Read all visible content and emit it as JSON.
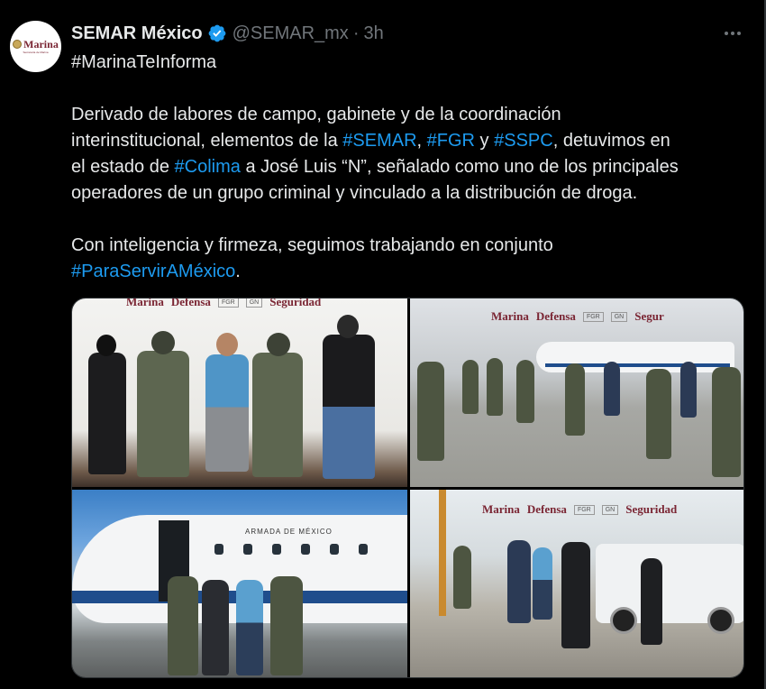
{
  "post": {
    "author_name": "SEMAR México",
    "handle": "@SEMAR_mx",
    "separator": "·",
    "time": "3h",
    "avatar": {
      "logo_text": "Marina",
      "logo_subtext": "Secretaría de Marina"
    },
    "hashtag_line": "#MarinaTeInforma",
    "paragraph1": {
      "line1": "Derivado de labores de campo, gabinete y de la coordinación",
      "line2_pre": "interinstitucional, elementos de la ",
      "tag_semar": "#SEMAR",
      "comma": ", ",
      "tag_fgr": "#FGR",
      "y": " y ",
      "tag_sspc": "#SSPC",
      "line2_post": ", detuvimos en",
      "line3_pre": "el estado de ",
      "tag_colima": "#Colima",
      "line3_post": " a José Luis “N”, señalado como uno de los principales",
      "line4": "operadores de un grupo criminal y vinculado a la distribución de droga."
    },
    "paragraph2": {
      "line1": "Con inteligencia y firmeza, seguimos trabajando en conjunto",
      "tag": "#ParaServirAMéxico",
      "period": "."
    }
  },
  "media": {
    "image1": {
      "banner": [
        "Marina",
        "Defensa",
        "FGR",
        "GN",
        "Seguridad"
      ]
    },
    "image2": {
      "banner": [
        "Marina",
        "Defensa",
        "FGR",
        "GN",
        "Segur"
      ]
    },
    "image3": {
      "plane_label": "ARMADA DE MÉXICO"
    },
    "image4": {
      "banner": [
        "Marina",
        "Defensa",
        "FGR",
        "GN",
        "Seguridad"
      ]
    }
  },
  "colors": {
    "background": "#000000",
    "text": "#e7e9ea",
    "secondary": "#71767b",
    "link": "#1d9bf0",
    "verified": "#1d9bf0",
    "marina_brand": "#7a2533"
  },
  "icons": {
    "verified": "verified-badge-icon",
    "more": "more-options-icon"
  }
}
